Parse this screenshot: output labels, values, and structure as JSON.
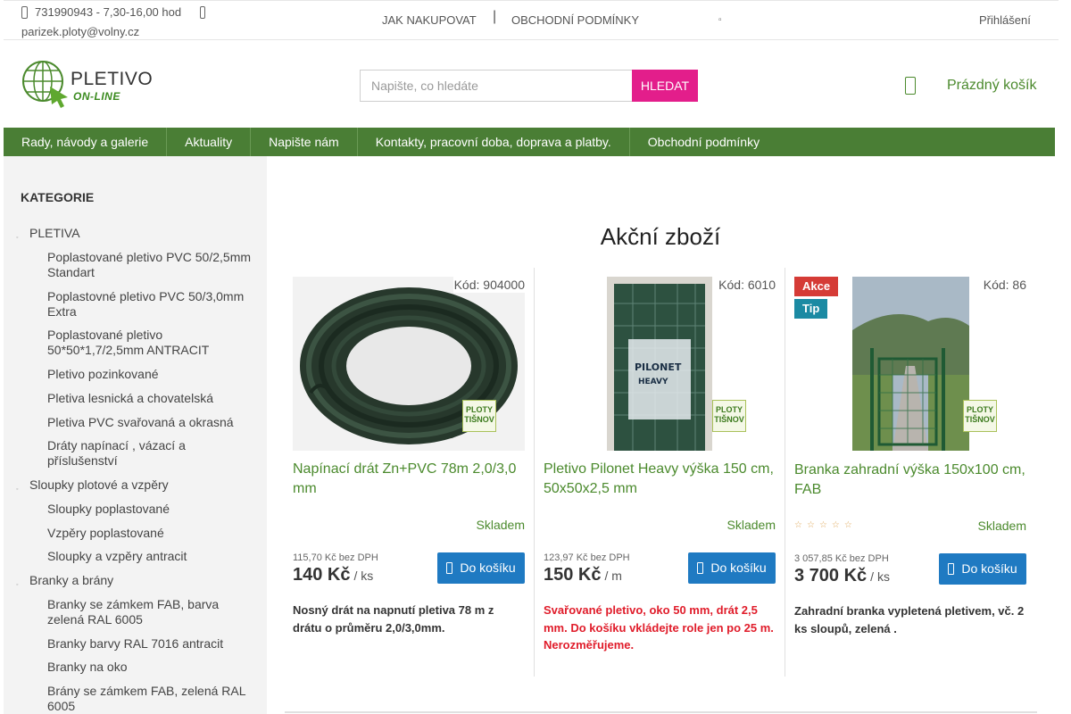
{
  "topbar": {
    "phone": "731990943 - 7,30-16,00 hod",
    "email": "parizek.ploty@volny.cz",
    "links": [
      "JAK NAKUPOVAT",
      "OBCHODNÍ PODMÍNKY"
    ],
    "separator": "|",
    "login": "Přihlášení"
  },
  "logo": {
    "line1": "PLETIVO",
    "line2": "ON-LINE"
  },
  "search": {
    "placeholder": "Napište, co hledáte",
    "button": "HLEDAT"
  },
  "cart": {
    "label": "Prázdný košík"
  },
  "nav": [
    "Rady, návody a galerie",
    "Aktuality",
    "Napište nám",
    "Kontakty, pracovní doba, doprava a platby.",
    "Obchodní podmínky"
  ],
  "sidebar": {
    "title": "KATEGORIE",
    "items": [
      "PLETIVA",
      "Poplastované pletivo PVC 50/2,5mm Standart",
      "Poplastovné pletivo PVC 50/3,0mm Extra",
      "Poplastované pletivo 50*50*1,7/2,5mm ANTRACIT",
      "Pletivo pozinkované",
      "Pletiva lesnická a chovatelská",
      "Pletiva PVC svařovaná a okrasná",
      "Dráty napínací , vázací a příslušenství",
      "Sloupky plotové a vzpěry",
      "Sloupky poplastované",
      "Vzpěry poplastované",
      "Sloupky a vzpěry antracit",
      "Branky a brány",
      "Branky se zámkem FAB, barva zelená RAL 6005",
      "Branky barvy RAL 7016 antracit",
      "Branky na oko",
      "Brány se zámkem FAB, zelená RAL 6005"
    ]
  },
  "main": {
    "title": "Akční zboží",
    "watermark": [
      "PLOTY",
      "TIŠNOV"
    ],
    "products": [
      {
        "code": "Kód: 904000",
        "name": "Napínací drát Zn+PVC 78m 2,0/3,0 mm",
        "stock": "Skladem",
        "net": "115,70 Kč bez DPH",
        "price": "140 Kč",
        "unit": "/ ks",
        "buy": "Do košíku",
        "desc": "Nosný drát na napnutí pletiva 78 m z drátu  o průměru 2,0/3,0mm."
      },
      {
        "code": "Kód: 6010",
        "name": "Pletivo Pilonet Heavy výška 150 cm, 50x50x2,5 mm",
        "stock": "Skladem",
        "net": "123,97 Kč bez DPH",
        "price": "150 Kč",
        "unit": "/ m",
        "buy": "Do košíku",
        "desc": "Svařované pletivo, oko 50 mm,  drát  2,5 mm. Do košíku vkládejte role jen po 25 m. Nerozměřujeme."
      },
      {
        "code": "Kód: 86",
        "badges": [
          "Akce",
          "Tip"
        ],
        "name": "Branka zahradní výška 150x100 cm, FAB",
        "rating_stars": 0,
        "stock": "Skladem",
        "net": "3 057,85 Kč bez DPH",
        "price": "3 700 Kč",
        "unit": "/ ks",
        "buy": "Do košíku",
        "desc": "Zahradní branka vypletená pletivem, vč. 2 ks sloupů, zelená ."
      }
    ]
  },
  "colors": {
    "green": "#4a7e35",
    "link_green": "#4b8a2d",
    "search_button": "#e31e8b",
    "buy_button": "#1f7ac2",
    "badge_akce": "#d53b36",
    "badge_tip": "#1b8aa3",
    "red_text": "#e01c2a"
  }
}
